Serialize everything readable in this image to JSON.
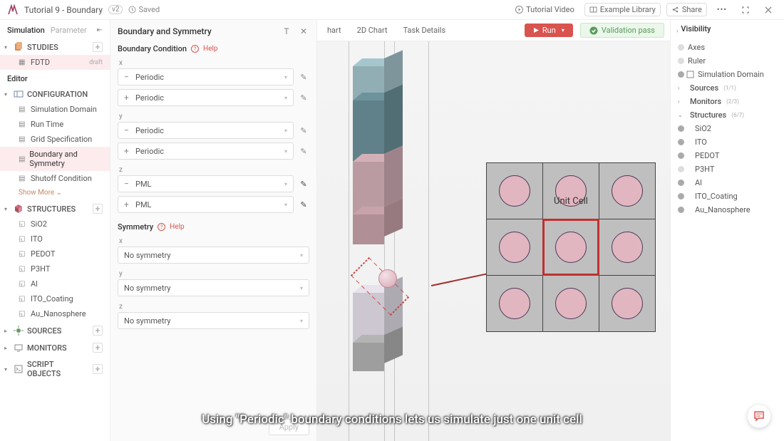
{
  "topbar": {
    "title": "Tutorial 9 - Boundary",
    "version_badge": "v2",
    "saved_label": "Saved",
    "tutorial_video": "Tutorial Video",
    "example_library": "Example Library",
    "share": "Share"
  },
  "left": {
    "tab_simulation": "Simulation",
    "tab_parameter": "Parameter",
    "studies_header": "STUDIES",
    "fdtd_item": "FDTD",
    "fdtd_status": "draft",
    "editor_label": "Editor",
    "configuration_header": "CONFIGURATION",
    "config_items": [
      "Simulation Domain",
      "Run Time",
      "Grid Specification",
      "Boundary and Symmetry",
      "Shutoff Condition"
    ],
    "show_more": "Show More",
    "structures_header": "STRUCTURES",
    "structure_items": [
      "SiO2",
      "ITO",
      "PEDOT",
      "P3HT",
      "Al",
      "ITO_Coating",
      "Au_Nanosphere"
    ],
    "sources_header": "SOURCES",
    "monitors_header": "MONITORS",
    "script_header": "SCRIPT OBJECTS"
  },
  "middle": {
    "title": "Boundary and Symmetry",
    "boundary_condition": "Boundary Condition",
    "help": "Help",
    "symmetry": "Symmetry",
    "axes": {
      "x": "x",
      "y": "y",
      "z": "z"
    },
    "bc_x_minus": "Periodic",
    "bc_x_plus": "Periodic",
    "bc_y_minus": "Periodic",
    "bc_y_plus": "Periodic",
    "bc_z_minus": "PML",
    "bc_z_plus": "PML",
    "sym_x": "No symmetry",
    "sym_y": "No symmetry",
    "sym_z": "No symmetry",
    "apply": "Apply"
  },
  "viewport": {
    "tab_hart": "hart",
    "tab_2d": "2D Chart",
    "tab_task": "Task Details",
    "run": "Run",
    "validation": "Validation pass",
    "unit_cell_label": "Unit Cell",
    "caption": "Using \"Periodic\" boundary conditions lets us simulate just one unit cell"
  },
  "right": {
    "title": "Visibility",
    "items_top": [
      "Axes",
      "Ruler"
    ],
    "sim_domain": "Simulation Domain",
    "sources": "Sources",
    "sources_count": "(1/1)",
    "monitors": "Monitors",
    "monitors_count": "(2/3)",
    "structures": "Structures",
    "structures_count": "(6/7)",
    "structure_items": [
      "SiO2",
      "ITO",
      "PEDOT",
      "P3HT",
      "Al",
      "ITO_Coating",
      "Au_Nanosphere"
    ]
  }
}
